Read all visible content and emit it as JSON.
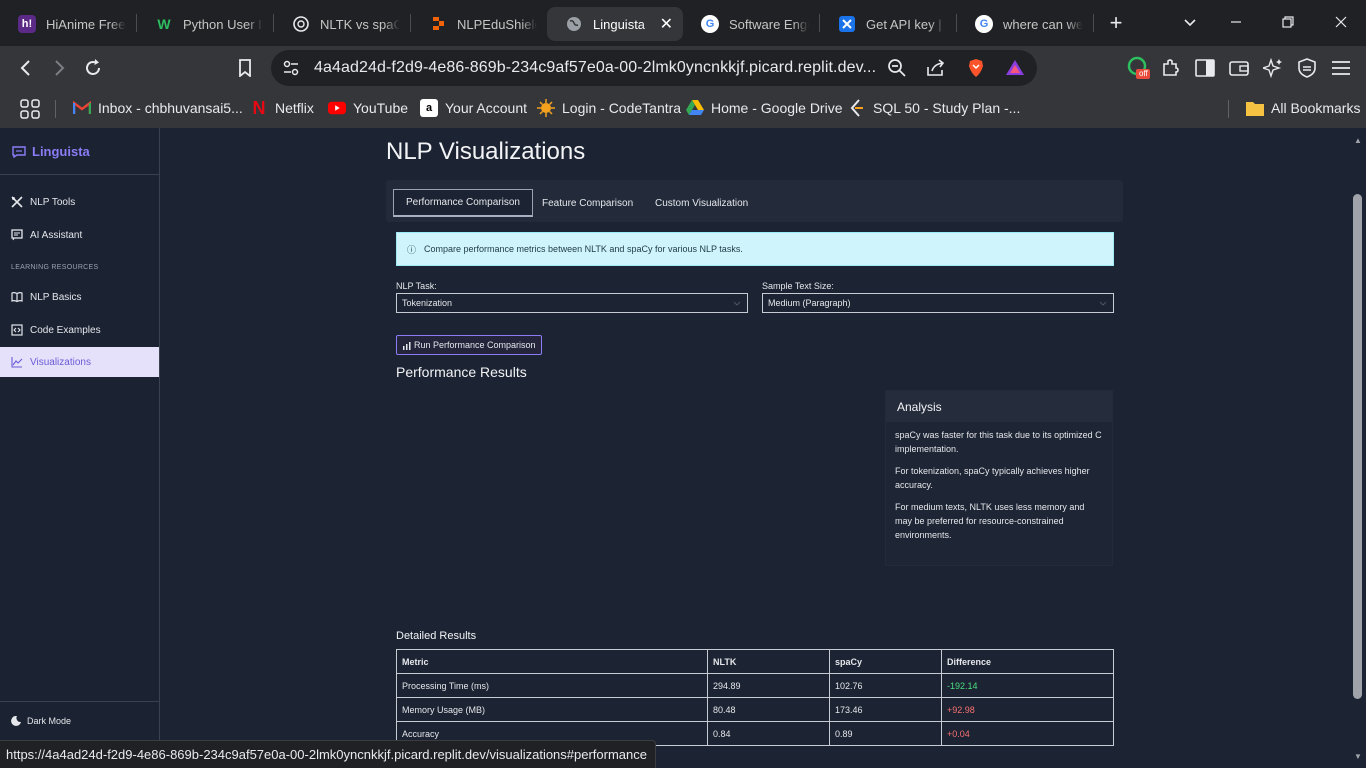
{
  "browser": {
    "tabs": [
      {
        "title": "HiAnime Free",
        "fav": "h!",
        "fav_bg": "#5b2a86",
        "icon": "hianime-icon"
      },
      {
        "title": "Python User In",
        "fav": "W",
        "fav_bg": "transparent",
        "icon": "wellfound-icon"
      },
      {
        "title": "NLTK vs spaCy",
        "fav": "",
        "fav_bg": "transparent",
        "icon": "chatgpt-icon"
      },
      {
        "title": "NLPEduShield",
        "fav": "",
        "fav_bg": "transparent",
        "icon": "replit-icon"
      },
      {
        "title": "Linguista",
        "fav": "",
        "fav_bg": "transparent",
        "icon": "globe-icon"
      },
      {
        "title": "Software Engi",
        "fav": "G",
        "fav_bg": "transparent",
        "icon": "google-icon"
      },
      {
        "title": "Get API key | G",
        "fav": "",
        "fav_bg": "transparent",
        "icon": "ai-studio-icon"
      },
      {
        "title": "where can we",
        "fav": "G",
        "fav_bg": "transparent",
        "icon": "google-icon"
      }
    ],
    "url": "4a4ad24d-f2d9-4e86-869b-234c9af57e0a-00-2lmk0yncnkkjf.picard.replit.dev...",
    "bookmarks": [
      {
        "label": "Inbox - chbhuvansai5...",
        "icon": "gmail-icon"
      },
      {
        "label": "Netflix",
        "icon": "netflix-icon"
      },
      {
        "label": "YouTube",
        "icon": "youtube-icon"
      },
      {
        "label": "Your Account",
        "icon": "amazon-icon"
      },
      {
        "label": "Login - CodeTantra",
        "icon": "codetantra-icon"
      },
      {
        "label": "Home - Google Drive",
        "icon": "google-drive-icon"
      },
      {
        "label": "SQL 50 - Study Plan -...",
        "icon": "leetcode-icon"
      }
    ],
    "all_bookmarks": "All Bookmarks",
    "extension_badge": "off",
    "status_url": "https://4a4ad24d-f2d9-4e86-869b-234c9af57e0a-00-2lmk0yncnkkjf.picard.replit.dev/visualizations#performance"
  },
  "sidebar": {
    "brand": "Linguista",
    "items": [
      {
        "label": "NLP Tools",
        "icon": "tools-icon"
      },
      {
        "label": "AI Assistant",
        "icon": "chat-icon"
      }
    ],
    "section": "LEARNING RESOURCES",
    "resources": [
      {
        "label": "NLP Basics",
        "icon": "book-icon"
      },
      {
        "label": "Code Examples",
        "icon": "code-icon"
      },
      {
        "label": "Visualizations",
        "icon": "chart-line-icon",
        "active": true
      }
    ],
    "dark_mode": "Dark Mode"
  },
  "main": {
    "title": "NLP Visualizations",
    "tabs": [
      "Performance Comparison",
      "Feature Comparison",
      "Custom Visualization"
    ],
    "info": "Compare performance metrics between NLTK and spaCy for various NLP tasks.",
    "task_label": "NLP Task:",
    "task_value": "Tokenization",
    "size_label": "Sample Text Size:",
    "size_value": "Medium (Paragraph)",
    "run_label": "Run Performance Comparison",
    "results_title": "Performance Results",
    "analysis": {
      "title": "Analysis",
      "points": [
        "spaCy was faster for this task due to its optimized C implementation.",
        "For tokenization, spaCy typically achieves higher accuracy.",
        "For medium texts, NLTK uses less memory and may be preferred for resource-constrained environments."
      ]
    },
    "detailed_title": "Detailed Results",
    "table": {
      "headers": [
        "Metric",
        "NLTK",
        "spaCy",
        "Difference"
      ],
      "rows": [
        [
          "Processing Time (ms)",
          "294.89",
          "102.76",
          "-192.14"
        ],
        [
          "Memory Usage (MB)",
          "80.48",
          "173.46",
          "+92.98"
        ],
        [
          "Accuracy",
          "0.84",
          "0.89",
          "+0.04"
        ]
      ]
    }
  },
  "colors": {
    "accent": "#8b7cf6",
    "positive_diff": "#4ade80",
    "negative_diff": "#f87171",
    "info_bg": "#cff4fc"
  }
}
